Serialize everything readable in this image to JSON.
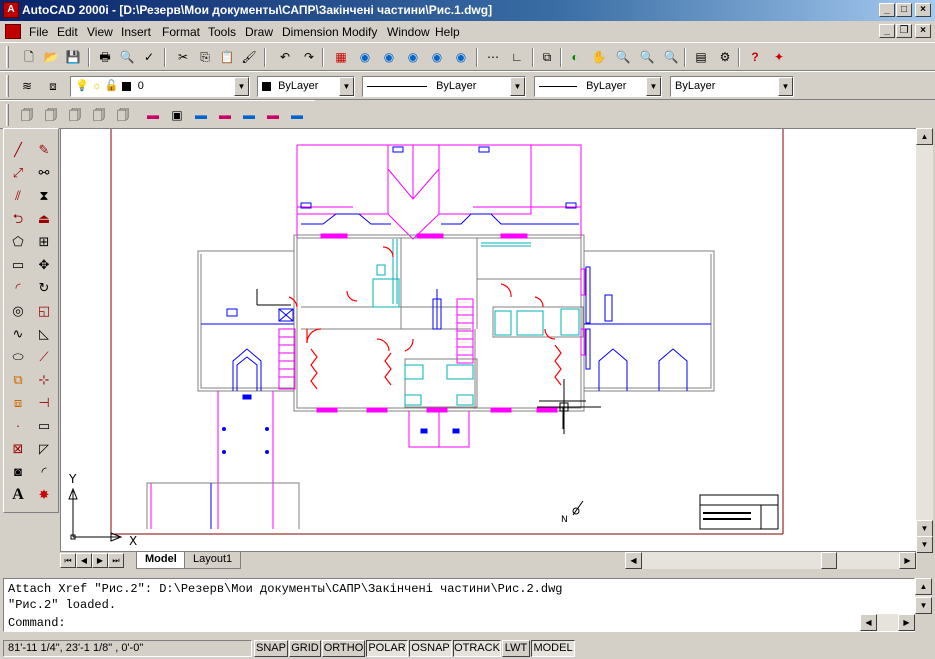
{
  "window": {
    "title": "AutoCAD 2000i - [D:\\Резерв\\Мои документы\\САПР\\Закінчені частини\\Рис.1.dwg]",
    "minimize": "_",
    "maximize": "□",
    "close": "×"
  },
  "menu": [
    "File",
    "Edit",
    "View",
    "Insert",
    "Format",
    "Tools",
    "Draw",
    "Dimension",
    "Modify",
    "Window",
    "Help"
  ],
  "properties": {
    "layer": "0",
    "color": "ByLayer",
    "linetype": "ByLayer",
    "lineweight": "ByLayer",
    "plotstyle": "ByLayer"
  },
  "tabs": {
    "model": "Model",
    "layout": "Layout1"
  },
  "command": {
    "lines": [
      "Attach Xref \"Рис.2\": D:\\Резерв\\Мои документы\\САПР\\Закінчені частини\\Рис.2.dwg",
      "\"Рис.2\" loaded.",
      "Command:"
    ]
  },
  "status": {
    "coords": "81'-11 1/4\",  23'-1 1/8\"  , 0'-0\"",
    "buttons": [
      "SNAP",
      "GRID",
      "ORTHO",
      "POLAR",
      "OSNAP",
      "OTRACK",
      "LWT",
      "MODEL"
    ],
    "active": [
      "POLAR",
      "OSNAP",
      "OTRACK",
      "MODEL"
    ]
  },
  "ucs": {
    "x": "X",
    "y": "Y"
  },
  "colors": {
    "magenta": "#ff00ff",
    "blue": "#0000ff",
    "red": "#ff0000",
    "cyan": "#00c0c0",
    "titlebar": "#0a246a"
  }
}
